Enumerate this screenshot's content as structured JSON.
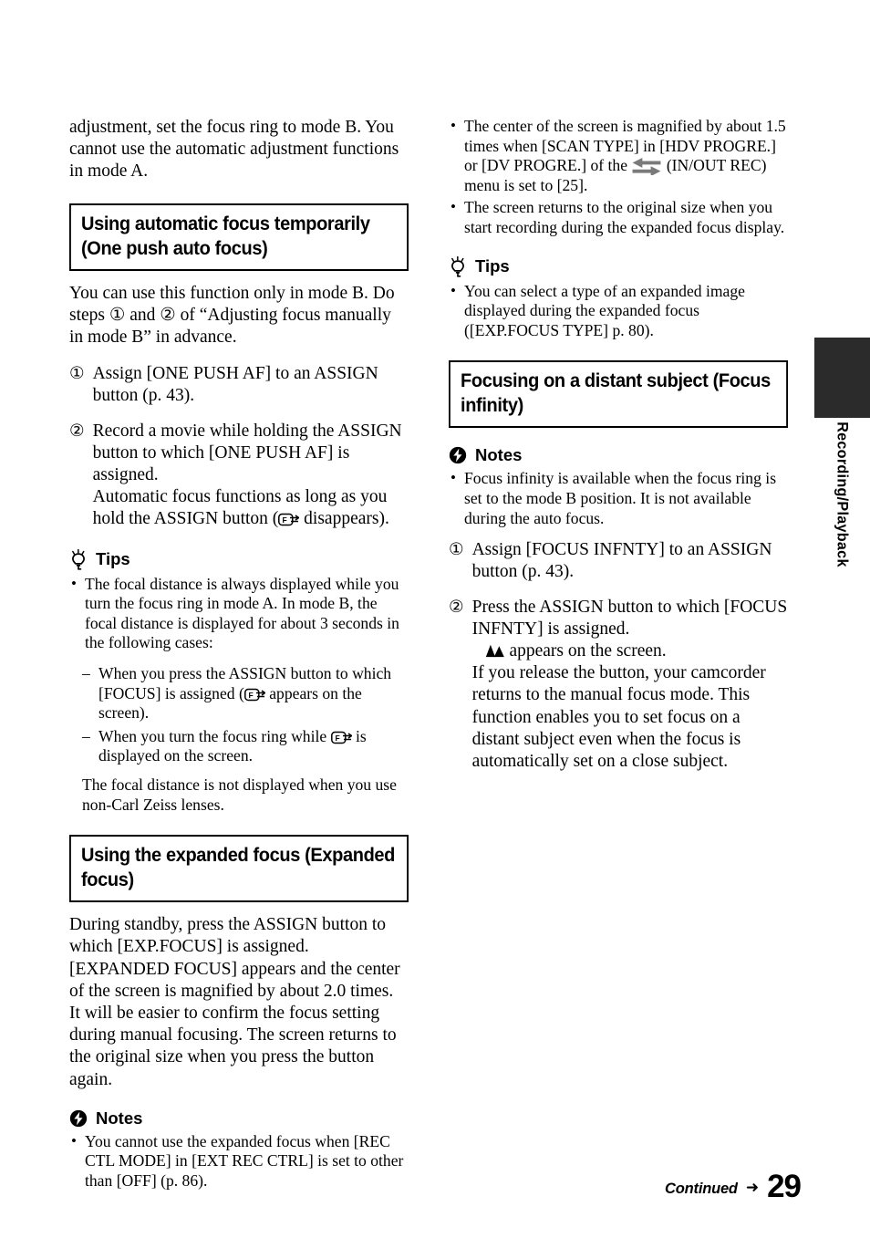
{
  "page": {
    "number": "29",
    "continued_label": "Continued",
    "continued_arrow": "➜",
    "side_tab_label": "Recording/Playback",
    "side_tab_color": "#2b2b2b"
  },
  "left_column": {
    "intro_paragraph": "adjustment, set the focus ring to mode B. You cannot use the automatic adjustment functions in mode A.",
    "section1": {
      "heading": "Using automatic focus temporarily (One push auto focus)",
      "intro": "You can use this function only in mode B. Do steps ① and ② of “Adjusting focus manually in mode B” in advance.",
      "steps": [
        {
          "num": "①",
          "text": "Assign [ONE PUSH AF] to an ASSIGN button (p. 43)."
        },
        {
          "num": "②",
          "text": "Record a movie while holding the ASSIGN button to which [ONE PUSH AF] is assigned.",
          "sub_before_icon": "Automatic focus functions as long as you hold the ASSIGN button (",
          "sub_after_icon": " disappears)."
        }
      ],
      "tips": {
        "label": "Tips",
        "icon": "lightbulb-icon",
        "bullets": [
          "The focal distance is always displayed while you turn the focus ring in mode A. In mode B, the focal distance is displayed for about 3 seconds in the following cases:"
        ],
        "dashes": [
          {
            "before_icon": "When you press the ASSIGN button to which [FOCUS] is assigned (",
            "after_icon": " appears on the screen)."
          },
          {
            "before_icon": "When you turn the focus ring while ",
            "after_icon": " is displayed on the screen."
          }
        ],
        "closing": "The focal distance is not displayed when you use non-Carl Zeiss lenses."
      }
    },
    "section2": {
      "heading": "Using the expanded focus (Expanded focus)",
      "body": "During standby, press the ASSIGN button to which [EXP.FOCUS] is assigned. [EXPANDED FOCUS] appears and the center of the screen is magnified by about 2.0 times. It will be easier to confirm the focus setting during manual focusing. The screen returns to the original size when you press the button again.",
      "notes": {
        "label": "Notes",
        "icon": "note-warning-icon",
        "bullets": [
          "You cannot use the expanded focus when [REC CTL MODE] in [EXT REC CTRL] is set to other than [OFF] (p. 86)."
        ]
      }
    }
  },
  "right_column": {
    "top_bullets": [
      {
        "before_icon": "The center of the screen is magnified by about 1.5 times when [SCAN TYPE] in [HDV PROGRE.] or [DV PROGRE.] of the ",
        "after_icon": " (IN/OUT REC) menu is set to [25]."
      },
      {
        "text": "The screen returns to the original size when you start recording during the expanded focus display."
      }
    ],
    "tips": {
      "label": "Tips",
      "icon": "lightbulb-icon",
      "bullets": [
        "You can select a type of an expanded image displayed during the expanded focus ([EXP.FOCUS TYPE] p. 80)."
      ]
    },
    "section3": {
      "heading": "Focusing on a distant subject (Focus infinity)",
      "notes": {
        "label": "Notes",
        "icon": "note-warning-icon",
        "bullets": [
          "Focus infinity is available when the focus ring is set to the mode B position. It is not available during the auto focus."
        ]
      },
      "steps": [
        {
          "num": "①",
          "text": "Assign [FOCUS INFNTY] to an ASSIGN button (p. 43)."
        },
        {
          "num": "②",
          "text": "Press the ASSIGN button to which [FOCUS INFNTY] is assigned.",
          "icon_line_after": " appears on the screen.",
          "sub": "If you release the button, your camcorder returns to the manual focus mode. This function enables you to set focus on a distant subject even when the focus is automatically set on a close subject."
        }
      ]
    }
  }
}
